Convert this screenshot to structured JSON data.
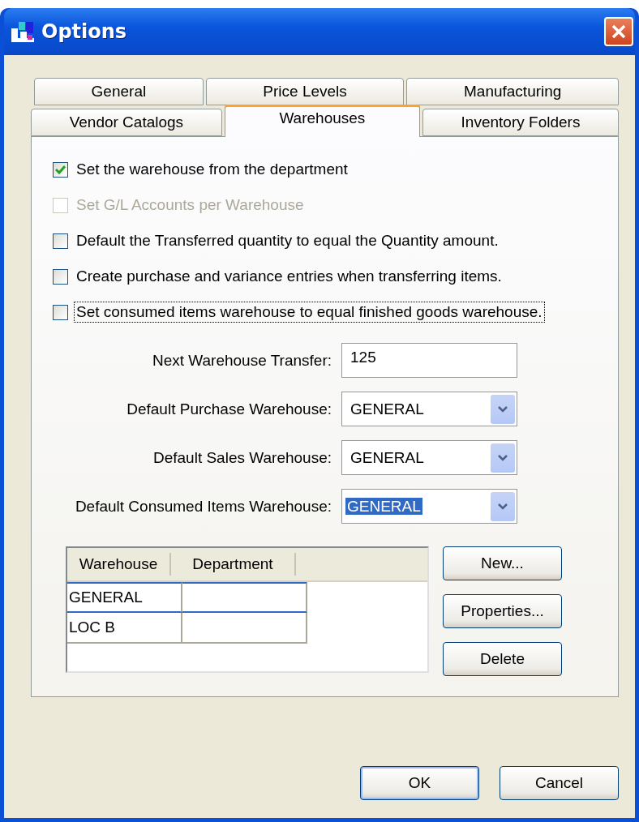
{
  "window": {
    "title": "Options"
  },
  "tab_rows": [
    {
      "tabs": [
        {
          "label": "General",
          "selected": false
        },
        {
          "label": "Price Levels",
          "selected": false
        },
        {
          "label": "Manufacturing",
          "selected": false
        }
      ]
    },
    {
      "tabs": [
        {
          "label": "Vendor Catalogs",
          "selected": false
        },
        {
          "label": "Warehouses",
          "selected": true
        },
        {
          "label": "Inventory Folders",
          "selected": false
        }
      ]
    }
  ],
  "options": [
    {
      "label": "Set the warehouse from the department",
      "checked": true,
      "disabled": false,
      "focused": false
    },
    {
      "label": "Set G/L Accounts per Warehouse",
      "checked": false,
      "disabled": true,
      "focused": false
    },
    {
      "label": "Default the Transferred quantity to equal the Quantity amount.",
      "checked": false,
      "disabled": false,
      "focused": false
    },
    {
      "label": "Create purchase and variance entries when transferring items.",
      "checked": false,
      "disabled": false,
      "focused": false
    },
    {
      "label": "Set consumed items warehouse to equal finished goods warehouse.",
      "checked": false,
      "disabled": false,
      "focused": true
    }
  ],
  "fields": [
    {
      "kind": "text",
      "label": "Next Warehouse Transfer:",
      "value": "125"
    },
    {
      "kind": "dropdown",
      "label": "Default Purchase Warehouse:",
      "value": "GENERAL",
      "selected": false
    },
    {
      "kind": "dropdown",
      "label": "Default Sales Warehouse:",
      "value": "GENERAL",
      "selected": false
    },
    {
      "kind": "dropdown",
      "label": "Default Consumed Items Warehouse:",
      "value": "GENERAL",
      "selected": true
    }
  ],
  "grid": {
    "columns": [
      "Warehouse",
      "Department"
    ],
    "rows": [
      {
        "warehouse": "GENERAL",
        "selected": true
      },
      {
        "warehouse": "LOC B",
        "selected": false
      }
    ]
  },
  "side_buttons": [
    "New...",
    "Properties...",
    "Delete"
  ],
  "buttons": [
    {
      "label": "OK",
      "default": true
    },
    {
      "label": "Cancel",
      "default": false
    }
  ]
}
